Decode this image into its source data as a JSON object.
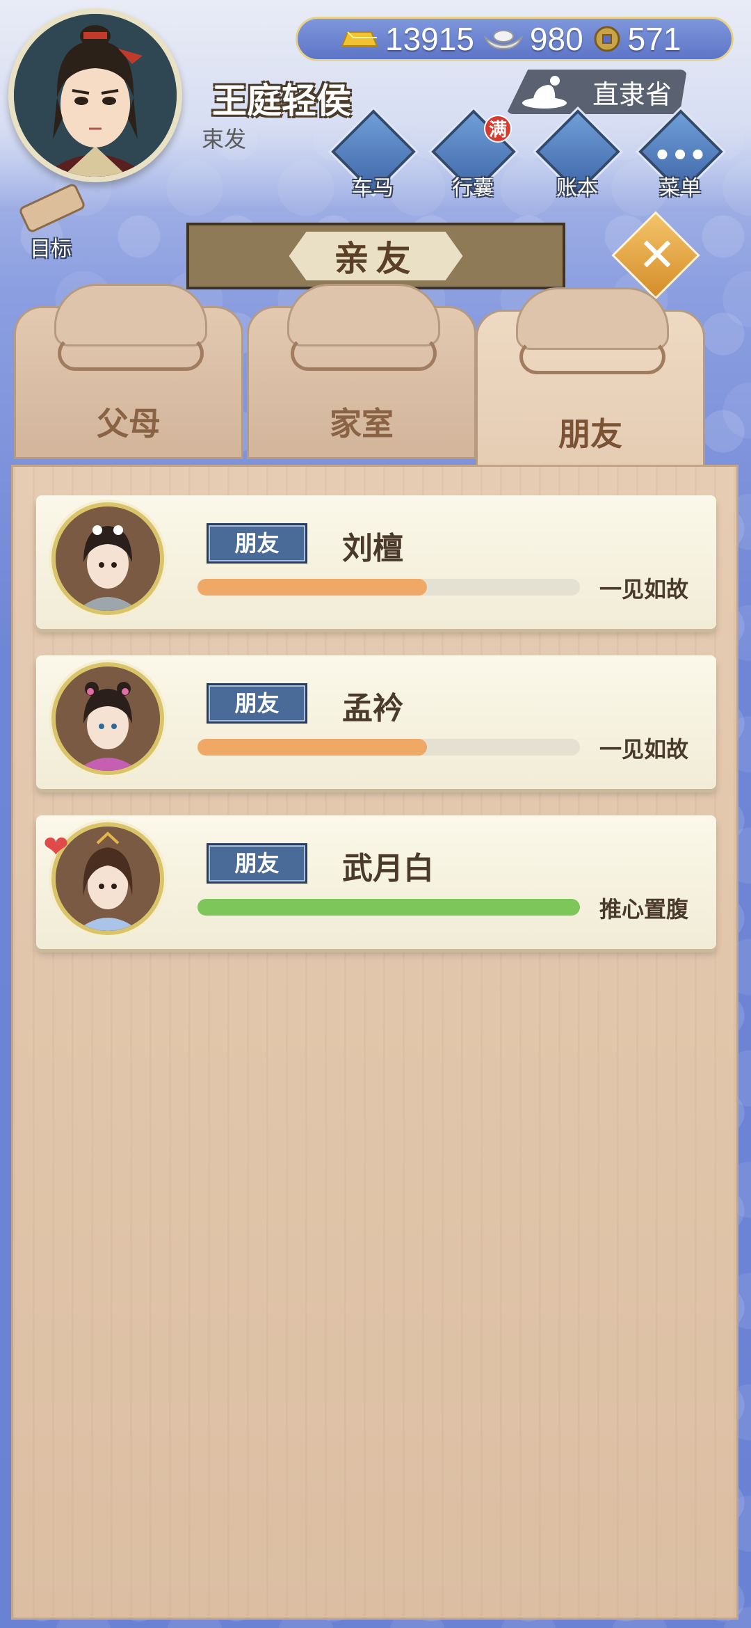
{
  "player": {
    "name": "王庭轻侯",
    "title": "束发"
  },
  "currency": {
    "gold": "13915",
    "silver": "980",
    "coin": "571"
  },
  "location": {
    "province": "直隶省"
  },
  "menu": [
    {
      "label": "车马",
      "badge": ""
    },
    {
      "label": "行囊",
      "badge": "满"
    },
    {
      "label": "账本",
      "badge": ""
    },
    {
      "label": "菜单",
      "badge": ""
    }
  ],
  "goal_label": "目标",
  "panel_title": "亲友",
  "tabs": [
    {
      "label": "父母"
    },
    {
      "label": "家室"
    },
    {
      "label": "朋友"
    }
  ],
  "friends": [
    {
      "tag": "朋友",
      "name": "刘檀",
      "level": "一见如故",
      "progress": 0.6,
      "bar_color": "#efa866"
    },
    {
      "tag": "朋友",
      "name": "孟衿",
      "level": "一见如故",
      "progress": 0.6,
      "bar_color": "#efa866"
    },
    {
      "tag": "朋友",
      "name": "武月白",
      "level": "推心置腹",
      "progress": 1.0,
      "bar_color": "#7cc65a"
    }
  ],
  "colors": {
    "accent": "#4a6a98",
    "panel": "#e2c8ad"
  }
}
